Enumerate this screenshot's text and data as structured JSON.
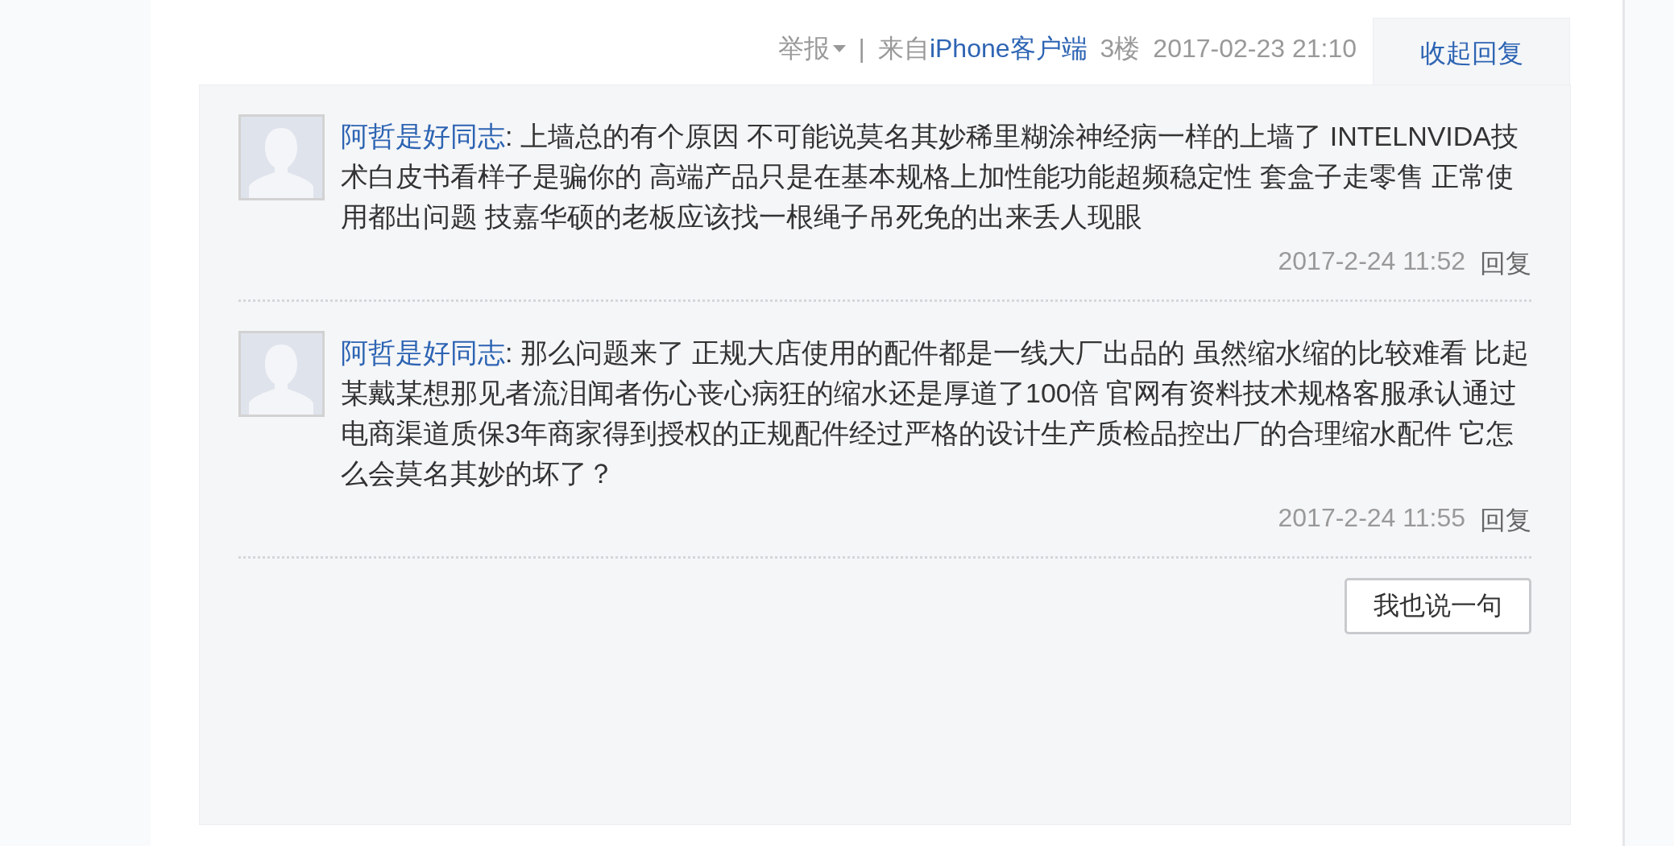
{
  "post_meta": {
    "report": "举报",
    "separator": "|",
    "source_prefix": "来自",
    "source": "iPhone客户端",
    "floor": "3楼",
    "time": "2017-02-23 21:10"
  },
  "collapse_tab": "收起回复",
  "replies": [
    {
      "author": "阿哲是好同志",
      "text": ": 上墙总的有个原因 不可能说莫名其妙稀里糊涂神经病一样的上墙了 INTELNVIDA技术白皮书看样子是骗你的 高端产品只是在基本规格上加性能功能超频稳定性 套盒子走零售 正常使用都出问题 技嘉华硕的老板应该找一根绳子吊死免的出来丢人现眼",
      "time": "2017-2-24 11:52",
      "reply_link": "回复"
    },
    {
      "author": "阿哲是好同志",
      "text": ": 那么问题来了 正规大店使用的配件都是一线大厂出品的 虽然缩水缩的比较难看 比起某戴某想那见者流泪闻者伤心丧心病狂的缩水还是厚道了100倍 官网有资料技术规格客服承认通过电商渠道质保3年商家得到授权的正规配件经过严格的设计生产质检品控出厂的合理缩水配件 它怎么会莫名其妙的坏了？",
      "time": "2017-2-24 11:55",
      "reply_link": "回复"
    }
  ],
  "reply_button": "我也说一句"
}
